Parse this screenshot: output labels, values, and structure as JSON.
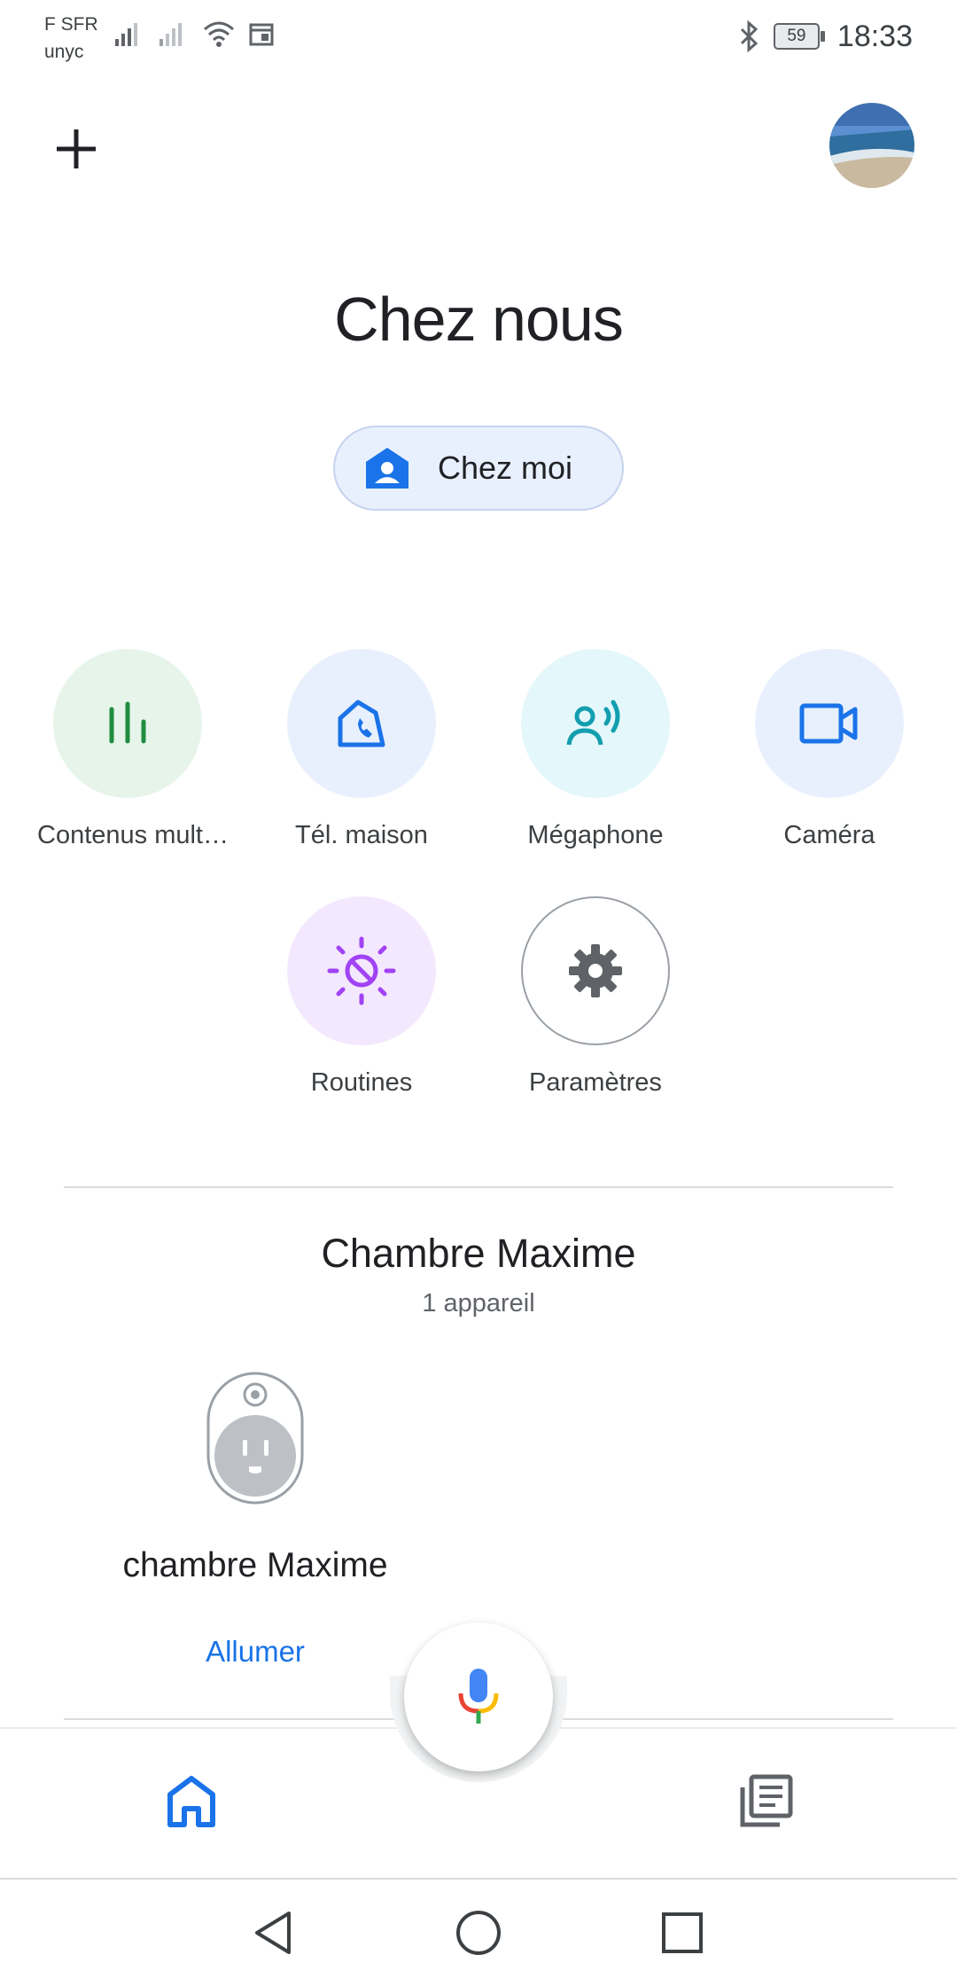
{
  "status_bar": {
    "carrier_line1": "F SFR",
    "carrier_line2": "unyc",
    "battery": "59",
    "time": "18:33"
  },
  "header": {
    "home_name": "Chez nous",
    "chip_label": "Chez moi"
  },
  "actions": [
    {
      "label": "Contenus mult…",
      "icon": "media-bars-icon",
      "color": "#1e8e3e",
      "bg": "#e6f4ea"
    },
    {
      "label": "Tél. maison",
      "icon": "home-phone-icon",
      "color": "#1a73e8",
      "bg": "#e8f0fe"
    },
    {
      "label": "Mégaphone",
      "icon": "broadcast-icon",
      "color": "#129eaf",
      "bg": "#e4f7fb"
    },
    {
      "label": "Caméra",
      "icon": "camera-icon",
      "color": "#1a73e8",
      "bg": "#e8f0fe"
    },
    {
      "label": "Routines",
      "icon": "routines-sun-icon",
      "color": "#a142f4",
      "bg": "#f3e8fd"
    },
    {
      "label": "Paramètres",
      "icon": "gear-icon",
      "color": "#5f6368",
      "bg": "#ffffff"
    }
  ],
  "room": {
    "title": "Chambre Maxime",
    "subtitle": "1 appareil",
    "device": {
      "name": "chambre Maxime",
      "action": "Allumer",
      "icon": "smart-plug-icon"
    }
  },
  "bottom_nav": {
    "home_icon": "home-icon",
    "feed_icon": "feed-icon",
    "mic_icon": "mic-icon"
  },
  "colors": {
    "accent": "#1a73e8"
  }
}
